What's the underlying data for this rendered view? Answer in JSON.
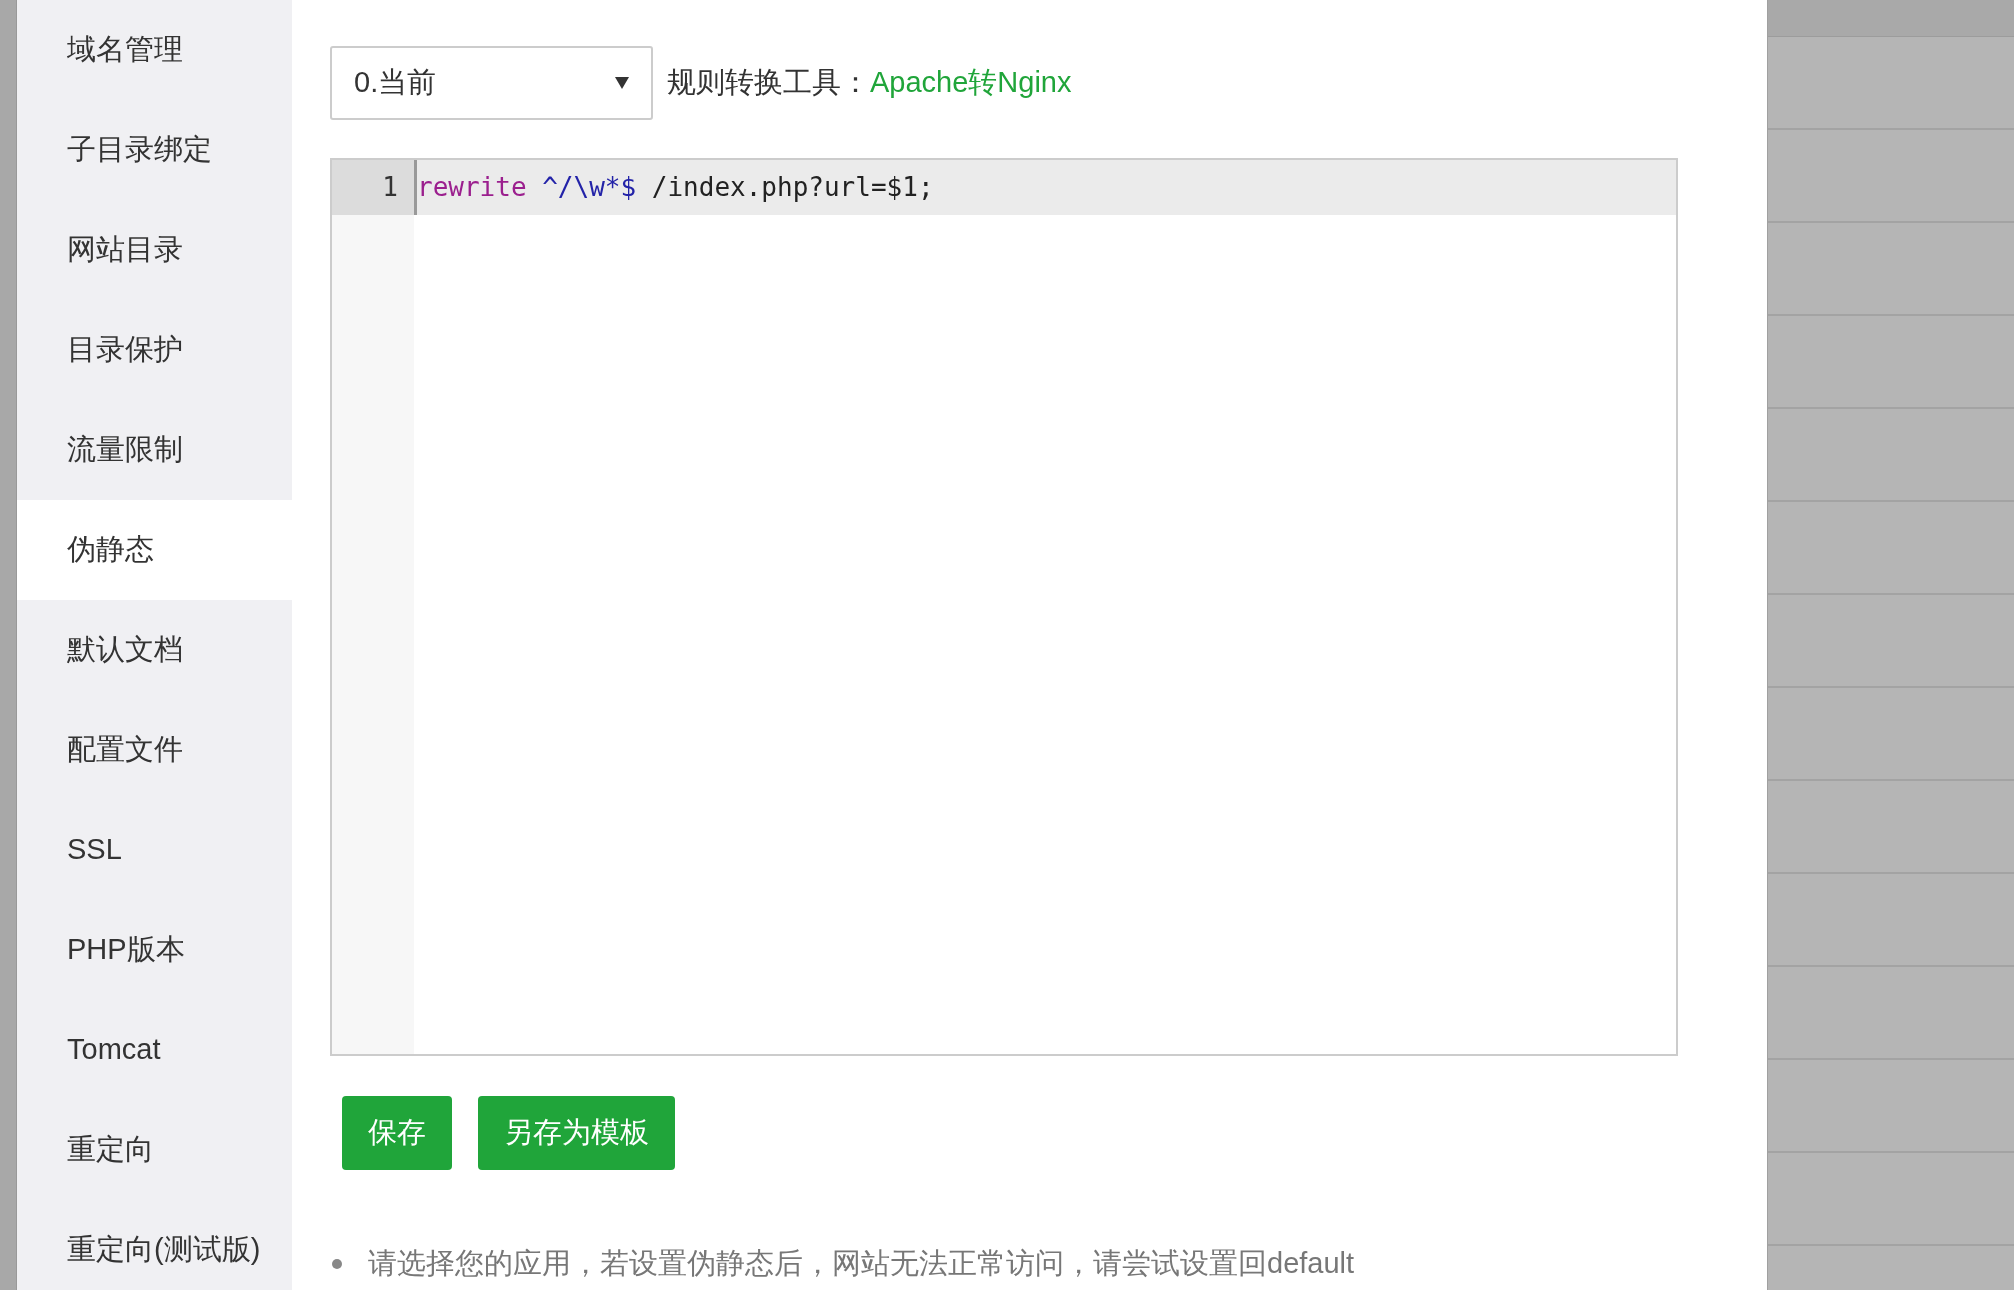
{
  "sidebar": {
    "items": [
      {
        "label": "域名管理",
        "selected": false
      },
      {
        "label": "子目录绑定",
        "selected": false
      },
      {
        "label": "网站目录",
        "selected": false
      },
      {
        "label": "目录保护",
        "selected": false
      },
      {
        "label": "流量限制",
        "selected": false
      },
      {
        "label": "伪静态",
        "selected": true
      },
      {
        "label": "默认文档",
        "selected": false
      },
      {
        "label": "配置文件",
        "selected": false
      },
      {
        "label": "SSL",
        "selected": false
      },
      {
        "label": "PHP版本",
        "selected": false
      },
      {
        "label": "Tomcat",
        "selected": false
      },
      {
        "label": "重定向",
        "selected": false
      },
      {
        "label": "重定向(测试版)",
        "selected": false
      }
    ]
  },
  "toolbar": {
    "select_value": "0.当前",
    "tool_label": "规则转换工具：",
    "tool_link": "Apache转Nginx"
  },
  "editor": {
    "lines": [
      {
        "number": "1",
        "active": true,
        "tokens": [
          {
            "kind": "keyword",
            "text": "rewrite"
          },
          {
            "kind": "regex",
            "text": "^/\\w*$"
          },
          {
            "kind": "plain",
            "text": "/index.php?url=$1;"
          }
        ]
      }
    ]
  },
  "buttons": [
    "保存",
    "另存为模板"
  ],
  "notes": [
    "请选择您的应用，若设置伪静态后，网站无法正常访问，请尝试设置回default"
  ]
}
